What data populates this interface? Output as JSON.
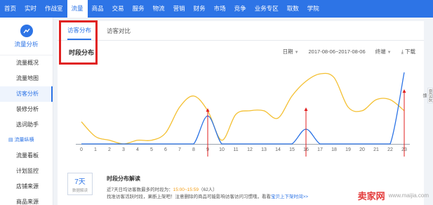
{
  "nav": {
    "items": [
      "首页",
      "实时",
      "作战室",
      "流量",
      "商品",
      "交易",
      "服务",
      "物流",
      "营销",
      "财务",
      "市场",
      "竞争",
      "业务专区",
      "取数",
      "学院"
    ],
    "active_index": 3
  },
  "sidebar": {
    "brand_label": "流量分析",
    "items": [
      {
        "label": "流量概况",
        "active": false
      },
      {
        "label": "流量地图",
        "active": false
      },
      {
        "label": "访客分析",
        "active": true
      },
      {
        "label": "装修分析",
        "active": false
      },
      {
        "label": "选词助手",
        "active": false
      }
    ],
    "section_label": "流量纵横",
    "items2": [
      {
        "label": "流量看板"
      },
      {
        "label": "计划监控"
      },
      {
        "label": "店铺来源"
      },
      {
        "label": "商品来源"
      }
    ]
  },
  "tabs": [
    {
      "label": "访客分布",
      "active": true
    },
    {
      "label": "访客对比",
      "active": false
    }
  ],
  "section_title": "时段分布",
  "controls": {
    "granularity": "日期",
    "date_range": "2017-08-06~2017-08-06",
    "device": "终端",
    "download": "下载"
  },
  "chart_data": {
    "type": "line",
    "x": [
      0,
      1,
      2,
      3,
      4,
      5,
      6,
      7,
      8,
      9,
      10,
      11,
      12,
      13,
      14,
      15,
      16,
      17,
      18,
      19,
      20,
      21,
      22,
      23
    ],
    "series": [
      {
        "values": [
          30,
          10,
          5,
          0,
          5,
          5,
          15,
          50,
          65,
          45,
          5,
          40,
          45,
          45,
          35,
          65,
          85,
          95,
          90,
          50,
          45,
          60,
          60,
          45
        ]
      },
      {
        "values": [
          0,
          0,
          0,
          0,
          0,
          0,
          0,
          0,
          0,
          38,
          0,
          0,
          0,
          0,
          0,
          0,
          20,
          0,
          0,
          0,
          0,
          0,
          0,
          97
        ]
      }
    ],
    "colors": [
      "#f4c032",
      "#2d74e6"
    ],
    "ylim": [
      0,
      100
    ],
    "annotation_hours": [
      9,
      16,
      23
    ],
    "annotation_color": "#e02020"
  },
  "interpretation": {
    "days_num": "7天",
    "days_sub": "数据解读",
    "title": "时段分布解读",
    "line1_prefix": "近7天日均访客数最多的时段为：",
    "line1_value": "15:00~15:59",
    "line1_suffix": "（62人）",
    "line2_prefix": "找准访客活跃时段，果断上架吧！注意删除的商品可能影响访客访问习惯哦，看看",
    "line2_link": "宝贝上下架时间>>"
  },
  "side_float": "意见反馈",
  "watermark": {
    "logo": "卖家网",
    "url": "www.maijia.com"
  }
}
